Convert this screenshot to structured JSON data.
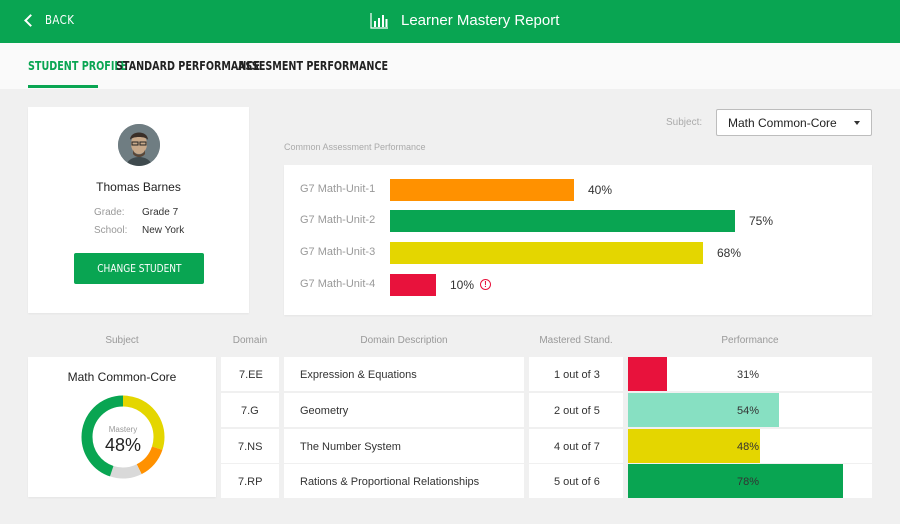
{
  "header": {
    "back_label": "BACK",
    "title": "Learner Mastery Report",
    "icon": "bar-chart-icon"
  },
  "tabs": [
    {
      "label": "STUDENT PROFILE",
      "active": true
    },
    {
      "label": "STANDARD PERFORMANCE",
      "active": false
    },
    {
      "label": "ASSESMENT PERFORMANCE",
      "active": false
    }
  ],
  "student": {
    "name": "Thomas Barnes",
    "grade_label": "Grade:",
    "grade": "Grade 7",
    "school_label": "School:",
    "school": "New York",
    "change_button": "CHANGE STUDENT"
  },
  "subject_filter": {
    "label": "Subject:",
    "value": "Math Common-Core"
  },
  "assessment": {
    "title": "Common Assessment Performance",
    "rows": [
      {
        "label": "G7 Math-Unit-1",
        "value": 40,
        "display": "40%",
        "color": "#ff9100",
        "warning": false
      },
      {
        "label": "G7 Math-Unit-2",
        "value": 75,
        "display": "75%",
        "color": "#09a552",
        "warning": false
      },
      {
        "label": "G7 Math-Unit-3",
        "value": 68,
        "display": "68%",
        "color": "#e4d600",
        "warning": false
      },
      {
        "label": "G7 Math-Unit-4",
        "value": 10,
        "display": "10%",
        "color": "#e8123c",
        "warning": true
      }
    ]
  },
  "table": {
    "headers": {
      "subject": "Subject",
      "domain": "Domain",
      "description": "Domain Description",
      "mastered": "Mastered Stand.",
      "performance": "Performance"
    },
    "mastery": {
      "subject": "Math Common-Core",
      "label": "Mastery",
      "value": "48%",
      "segments": [
        {
          "share": 0.3,
          "color": "#e4d600"
        },
        {
          "share": 0.125,
          "color": "#ff9100"
        },
        {
          "share": 0.125,
          "color": "#d9d9d9"
        },
        {
          "share": 0.45,
          "color": "#09a552"
        }
      ]
    },
    "rows": [
      {
        "domain": "7.EE",
        "description": "Expression & Equations",
        "mastered": "1 out of 3",
        "performance": "31%",
        "fill": 0.16,
        "color": "#e8123c"
      },
      {
        "domain": "7.G",
        "description": "Geometry",
        "mastered": "2 out of 5",
        "performance": "54%",
        "fill": 0.62,
        "color": "#87e0c2"
      },
      {
        "domain": "7.NS",
        "description": "The Number System",
        "mastered": "4 out of 7",
        "performance": "48%",
        "fill": 0.54,
        "color": "#e4d600"
      },
      {
        "domain": "7.RP",
        "description": "Rations & Proportional Relationships",
        "mastered": "5 out of 6",
        "performance": "78%",
        "fill": 0.88,
        "color": "#09a552"
      }
    ]
  }
}
